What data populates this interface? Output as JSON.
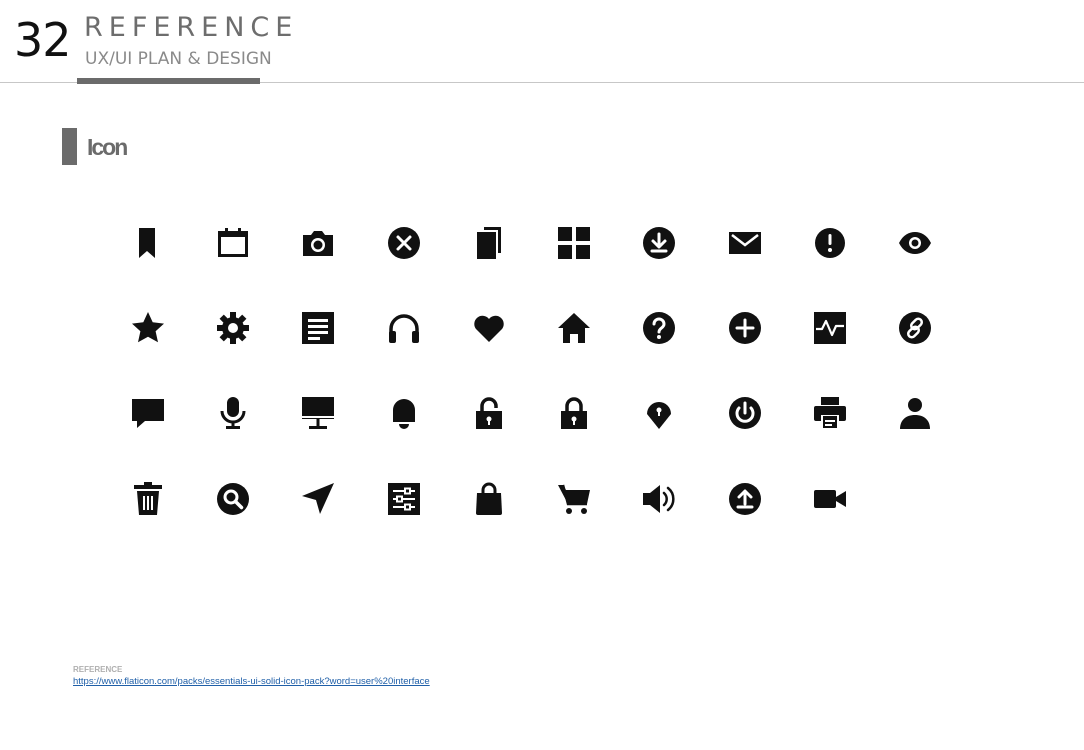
{
  "header": {
    "page_number": "32",
    "title": "REFERENCE",
    "subtitle": "UX/UI PLAN & DESIGN"
  },
  "section": {
    "title": "Icon"
  },
  "icon_color": "#111111",
  "icons": [
    "bookmark-icon",
    "calendar-icon",
    "camera-icon",
    "close-circle-icon",
    "copy-icon",
    "grid-icon",
    "download-icon",
    "mail-icon",
    "alert-icon",
    "eye-icon",
    "star-icon",
    "gear-icon",
    "document-icon",
    "headphones-icon",
    "heart-icon",
    "home-icon",
    "help-icon",
    "add-circle-icon",
    "activity-icon",
    "link-icon",
    "chat-icon",
    "microphone-icon",
    "monitor-icon",
    "bell-icon",
    "unlock-icon",
    "lock-icon",
    "location-pin-icon",
    "power-icon",
    "printer-icon",
    "user-icon",
    "trash-icon",
    "search-icon",
    "navigation-icon",
    "settings-sliders-icon",
    "shopping-bag-icon",
    "cart-icon",
    "volume-icon",
    "upload-icon",
    "video-icon"
  ],
  "reference": {
    "label": "REFERENCE",
    "url": "https://www.flaticon.com/packs/essentials-ui-solid-icon-pack?word=user%20interface"
  }
}
